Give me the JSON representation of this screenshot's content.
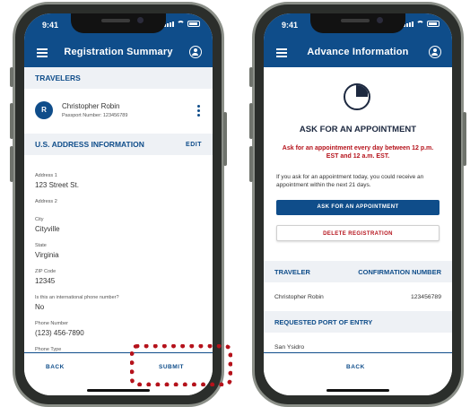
{
  "status": {
    "time": "9:41"
  },
  "left": {
    "title": "Registration Summary",
    "travelers_header": "TRAVELERS",
    "traveler": {
      "initial": "R",
      "name": "Christopher Robin",
      "passport": "Passport Number: 123456789"
    },
    "address_header": "U.S. ADDRESS INFORMATION",
    "edit_label": "EDIT",
    "fields": [
      {
        "label": "Address 1",
        "value": "123 Street St."
      },
      {
        "label": "Address 2",
        "value": ""
      },
      {
        "label": "City",
        "value": "Cityville"
      },
      {
        "label": "State",
        "value": "Virginia"
      },
      {
        "label": "ZIP Code",
        "value": "12345"
      },
      {
        "label": "Is this an international phone number?",
        "value": "No"
      },
      {
        "label": "Phone Number",
        "value": "(123) 456-7890"
      },
      {
        "label": "Phone Type",
        "value": ""
      }
    ],
    "back_label": "BACK",
    "submit_label": "SUBMIT"
  },
  "right": {
    "title": "Advance Information",
    "heading": "ASK FOR AN APPOINTMENT",
    "warning": "Ask for an appointment every day between 12 p.m. EST and 12 a.m. EST.",
    "info": "If you ask for an appointment today, you could receive an appointment within the next 21 days.",
    "ask_button": "ASK FOR AN APPOINTMENT",
    "delete_button": "DELETE REGISTRATION",
    "table_header_traveler": "TRAVELER",
    "table_header_confirmation": "CONFIRMATION NUMBER",
    "traveler_name": "Christopher Robin",
    "confirmation_number": "123456789",
    "port_header": "REQUESTED PORT OF ENTRY",
    "port_value": "San Ysidro",
    "back_label": "BACK"
  },
  "colors": {
    "primary": "#0f4d8a",
    "alert": "#b5121b",
    "section_bg": "#eef1f5"
  }
}
